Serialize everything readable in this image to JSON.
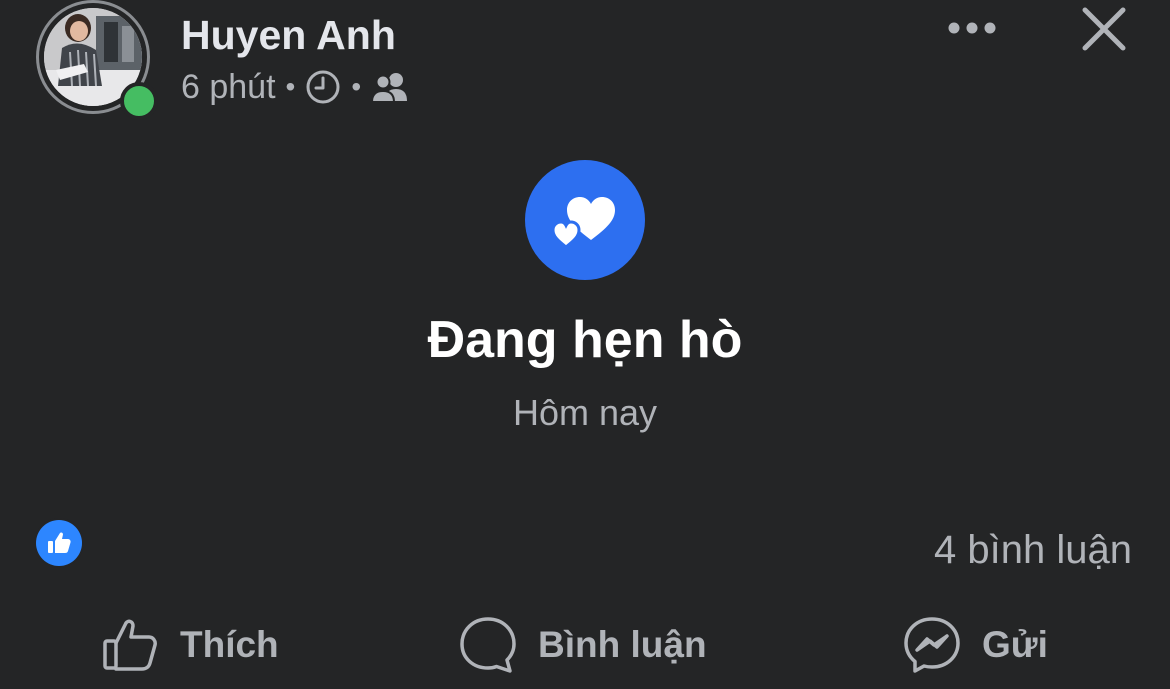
{
  "post": {
    "author_name": "Huyen Anh",
    "time": "6 phút",
    "meta_sep_1": "•",
    "meta_sep_2": "•",
    "online": true,
    "avatar_icon": "profile-photo",
    "time_icon": "clock-icon",
    "audience_icon": "friends-icon",
    "more_icon": "more-horizontal-icon",
    "close_icon": "close-icon"
  },
  "life_event": {
    "icon": "hearts-icon",
    "title": "Đang hẹn hò",
    "date": "Hôm nay"
  },
  "engagement": {
    "reaction_icon": "like-reaction-icon",
    "comment_count": "4 bình luận"
  },
  "actions": {
    "like_label": "Thích",
    "comment_label": "Bình luận",
    "send_label": "Gửi"
  },
  "colors": {
    "background": "#242526",
    "primary_text": "#e4e6eb",
    "secondary_text": "#b0b3b8",
    "event_blue": "#2d6ff0",
    "like_blue": "#2d86ff",
    "online_green": "#45bd62"
  }
}
